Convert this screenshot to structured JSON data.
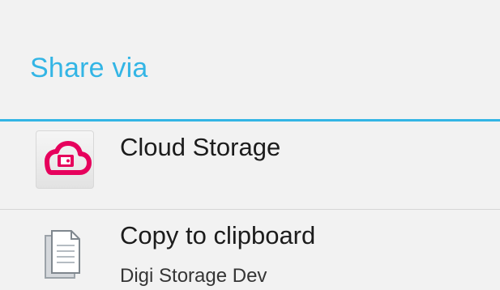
{
  "dialog": {
    "title": "Share via",
    "accent_color": "#33b5e5"
  },
  "items": [
    {
      "label": "Cloud Storage",
      "icon": "cloud-storage-icon",
      "icon_color": "#e6005c"
    },
    {
      "label": "Copy to clipboard",
      "sublabel": "Digi Storage Dev",
      "icon": "clipboard-icon"
    }
  ]
}
